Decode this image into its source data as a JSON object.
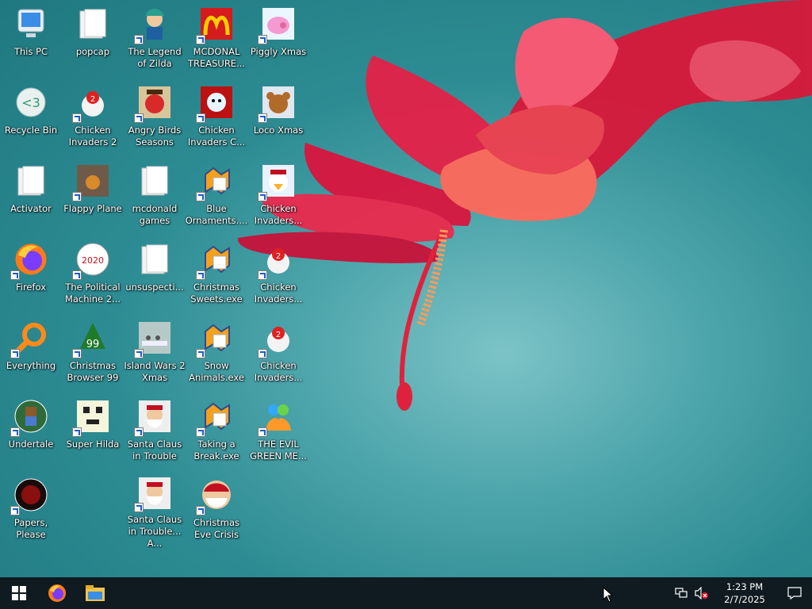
{
  "desktop": {
    "icons": [
      {
        "label": "This PC",
        "icon": "computer-icon"
      },
      {
        "label": "Recycle Bin",
        "icon": "recycle-bin-icon"
      },
      {
        "label": "Activator",
        "icon": "folder-icon"
      },
      {
        "label": "Firefox",
        "icon": "firefox-icon"
      },
      {
        "label": "Everything",
        "icon": "everything-search-icon"
      },
      {
        "label": "Undertale",
        "icon": "undertale-icon"
      },
      {
        "label": "Papers, Please",
        "icon": "papers-please-icon"
      },
      {
        "label": "popcap",
        "icon": "folder-icon"
      },
      {
        "label": "Chicken Invaders 2",
        "icon": "chicken-invaders-icon"
      },
      {
        "label": "Flappy Plane",
        "icon": "flappy-plane-icon"
      },
      {
        "label": "The Political Machine 2...",
        "icon": "political-machine-icon"
      },
      {
        "label": "Christmas Browser 99",
        "icon": "christmas-tree-icon"
      },
      {
        "label": "Super Hilda",
        "icon": "super-hilda-icon"
      },
      {
        "label": "The Legend of Zilda",
        "icon": "zilda-icon"
      },
      {
        "label": "Angry Birds Seasons",
        "icon": "angry-birds-icon"
      },
      {
        "label": "mcdonald games",
        "icon": "folder-icon"
      },
      {
        "label": "unsuspecti...",
        "icon": "folder-icon"
      },
      {
        "label": "Island Wars 2 Xmas",
        "icon": "island-wars-icon"
      },
      {
        "label": "Santa Claus in Trouble",
        "icon": "santa-icon"
      },
      {
        "label": "Santa Claus in Trouble... A...",
        "icon": "santa-icon"
      },
      {
        "label": "MCDONAL TREASURE...",
        "icon": "mcdonalds-icon"
      },
      {
        "label": "Chicken Invaders C...",
        "icon": "snowman-icon"
      },
      {
        "label": "Blue Ornaments....",
        "icon": "puzzle-icon"
      },
      {
        "label": "Christmas Sweets.exe",
        "icon": "puzzle-icon"
      },
      {
        "label": "Snow Animals.exe",
        "icon": "puzzle-icon"
      },
      {
        "label": "Taking a Break.exe",
        "icon": "puzzle-icon"
      },
      {
        "label": "Christmas Eve Crisis",
        "icon": "santa-face-icon"
      },
      {
        "label": "Piggly Xmas",
        "icon": "pig-icon"
      },
      {
        "label": "Loco Xmas",
        "icon": "teddy-bear-icon"
      },
      {
        "label": "Chicken Invaders...",
        "icon": "chicken-santa-icon"
      },
      {
        "label": "Chicken Invaders...",
        "icon": "chicken-invaders-icon"
      },
      {
        "label": "Chicken Invaders...",
        "icon": "chicken-invaders-icon"
      },
      {
        "label": "THE EVIL GREEN ME...",
        "icon": "messenger-icon"
      }
    ]
  },
  "taskbar": {
    "start_icon": "windows-start-icon",
    "pinned": [
      {
        "icon": "firefox-icon"
      },
      {
        "icon": "file-explorer-icon"
      }
    ],
    "tray": {
      "network_icon": "network-icon",
      "volume_icon": "volume-muted-icon",
      "time": "1:23 PM",
      "date": "2/7/2025",
      "notification_icon": "action-center-icon"
    }
  },
  "colors": {
    "taskbar_bg": "#0f1b21",
    "wallpaper_teal": "#2d8c93",
    "flower_red": "#e0213e"
  }
}
